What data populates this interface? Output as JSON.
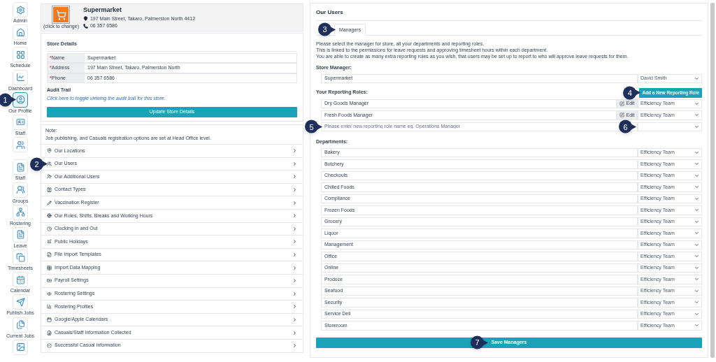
{
  "sidebar": {
    "items": [
      {
        "label": "Admin",
        "selected": false
      },
      {
        "label": "Home",
        "selected": false
      },
      {
        "label": "Schedule",
        "selected": false
      },
      {
        "label": "Dashboard",
        "selected": false
      },
      {
        "label": "Our Profile",
        "selected": true,
        "callout": "1"
      },
      {
        "label": "Staff",
        "selected": false
      },
      {
        "selected": false
      },
      {
        "label": "Staff",
        "selected": false
      },
      {
        "label": "Groups",
        "selected": false
      },
      {
        "label": "Rostering",
        "selected": false
      },
      {
        "label": "Leave",
        "selected": false
      },
      {
        "label": "Timesheets",
        "selected": false
      },
      {
        "label": "Calendar",
        "selected": false
      },
      {
        "label": "Publish Jobs",
        "selected": false
      },
      {
        "label": "Current Jobs",
        "selected": false
      },
      {
        "selected": false
      }
    ]
  },
  "store_header": {
    "logo_caption": "(click to change)",
    "name": "Supermarket",
    "address": "197 Main Street, Takaro, Palmerston North 4412",
    "phone": "06 357 6586"
  },
  "store_details": {
    "title": "Store Details",
    "fields": [
      {
        "mark": "*",
        "label": "Name",
        "value": "Supermarket"
      },
      {
        "mark": "*",
        "label": "Address",
        "value": "197 Main Street, Takaro, Palmerston North"
      },
      {
        "mark": "*",
        "label": "Phone",
        "value": "06 357 6586"
      }
    ],
    "audit_title": "Audit Trail",
    "audit_link": "Click here to toggle viewing the audit trail for this store.",
    "update_button": "Update Store Details"
  },
  "note": {
    "title": "Note:",
    "text": "Job publishing, and Casuals registration options are set at Head Office level."
  },
  "menu": [
    {
      "label": "Our Locations"
    },
    {
      "label": "Our Users",
      "callout": "2"
    },
    {
      "label": "Our Additional Users"
    },
    {
      "label": "Contact Types"
    },
    {
      "label": "Vaccination Register"
    },
    {
      "label": "Our Roles, Shifts, Breaks and Working Hours"
    },
    {
      "label": "Clocking In and Out"
    },
    {
      "label": "Public Holidays"
    },
    {
      "label": "File Import Templates"
    },
    {
      "label": "Import Data Mapping"
    },
    {
      "label": "Payroll Settings"
    },
    {
      "label": "Rostering Settings"
    },
    {
      "label": "Rostering Profiles"
    },
    {
      "label": "Google/Apple Calendars"
    },
    {
      "label": "Casuals/Staff Information Collected"
    },
    {
      "label": "Successful Casual Information"
    }
  ],
  "users": {
    "title": "Our Users",
    "tabs": [
      {
        "label": "Managers",
        "selected": true,
        "callout": "3"
      }
    ],
    "intro": [
      "Please select the manager for store, all your departments and reporting roles.",
      "This is linked to the permissions for leave requests and approving timesheet hours within each department.",
      "You are able to create as many extra reporting roles as you wish, that users may be set up to report to who will approve leave requests for them."
    ],
    "store_manager_label": "Store Manager:",
    "store_manager": {
      "name": "Supermarket",
      "value": "David Smith"
    },
    "roles_label": "Your Reporting Roles:",
    "add_role_button": {
      "label": "Add a New Reporting Role",
      "callout": "4"
    },
    "roles": [
      {
        "name": "Dry Goods Manager",
        "edit": "Edit",
        "value": "Efficiency Team"
      },
      {
        "name": "Fresh Foods Manager",
        "edit": "Edit",
        "value": "Efficiency Team"
      }
    ],
    "new_role": {
      "placeholder": "Please enter new reporting role name eg. Operations Manager",
      "callout": "5",
      "select_callout": "6"
    },
    "departments_label": "Departments:",
    "departments": [
      {
        "name": "Bakery",
        "value": "Efficiency Team"
      },
      {
        "name": "Butchery",
        "value": "Efficiency Team"
      },
      {
        "name": "Checkouts",
        "value": "Efficiency Team"
      },
      {
        "name": "Chilled Foods",
        "value": "Efficiency Team"
      },
      {
        "name": "Compliance",
        "value": "Efficiency Team"
      },
      {
        "name": "Frozen Foods",
        "value": "Efficiency Team"
      },
      {
        "name": "Grocery",
        "value": "Efficiency Team"
      },
      {
        "name": "Liquor",
        "value": "Efficiency Team"
      },
      {
        "name": "Management",
        "value": "Efficiency Team"
      },
      {
        "name": "Office",
        "value": "Efficiency Team"
      },
      {
        "name": "Online",
        "value": "Efficiency Team"
      },
      {
        "name": "Produce",
        "value": "Efficiency Team"
      },
      {
        "name": "Seafood",
        "value": "Efficiency Team"
      },
      {
        "name": "Security",
        "value": "Efficiency Team"
      },
      {
        "name": "Service Deli",
        "value": "Efficiency Team"
      },
      {
        "name": "Storeroom",
        "value": "Efficiency Team"
      }
    ],
    "save_button": {
      "label": "Save Managers",
      "callout": "7"
    }
  }
}
